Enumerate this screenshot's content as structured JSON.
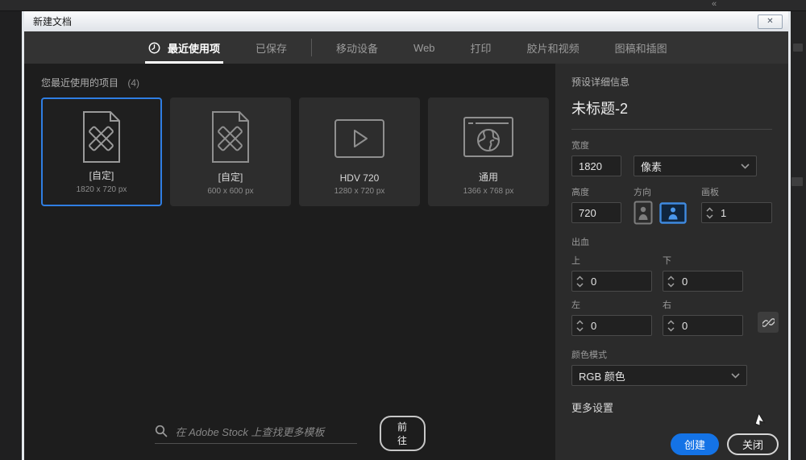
{
  "background": {
    "collapse_glyph": "«"
  },
  "window": {
    "title": "新建文档",
    "close_glyph": "✕"
  },
  "tabs": [
    {
      "label": "最近使用项"
    },
    {
      "label": "已保存"
    },
    {
      "label": "移动设备"
    },
    {
      "label": "Web"
    },
    {
      "label": "打印"
    },
    {
      "label": "胶片和视频"
    },
    {
      "label": "图稿和插图"
    }
  ],
  "recent": {
    "heading": "您最近使用的项目",
    "count": "(4)",
    "cards": [
      {
        "name": "[自定]",
        "dims": "1820 x 720 px",
        "icon": "custom-document-icon",
        "selected": true
      },
      {
        "name": "[自定]",
        "dims": "600 x 600 px",
        "icon": "custom-document-icon",
        "selected": false
      },
      {
        "name": "HDV 720",
        "dims": "1280 x 720 px",
        "icon": "video-icon",
        "selected": false
      },
      {
        "name": "通用",
        "dims": "1366 x 768 px",
        "icon": "web-browser-icon",
        "selected": false
      }
    ]
  },
  "search": {
    "placeholder": "在 Adobe Stock 上查找更多模板",
    "go_label": "前往"
  },
  "panel": {
    "heading": "预设详细信息",
    "doc_title": "未标题-2",
    "width_label": "宽度",
    "width_value": "1820",
    "unit_value": "像素",
    "height_label": "高度",
    "height_value": "720",
    "orientation_label": "方向",
    "artboard_label": "画板",
    "artboard_value": "1",
    "bleed_label": "出血",
    "bleed_top_label": "上",
    "bleed_top_value": "0",
    "bleed_bottom_label": "下",
    "bleed_bottom_value": "0",
    "bleed_left_label": "左",
    "bleed_left_value": "0",
    "bleed_right_label": "右",
    "bleed_right_value": "0",
    "color_mode_label": "颜色模式",
    "color_mode_value": "RGB 颜色",
    "more_settings_label": "更多设置",
    "create_label": "创建",
    "close_label": "关闭"
  },
  "colors": {
    "accent": "#1473e6",
    "selection_border": "#2f7ee3",
    "orientation_active": "#3f8ae0"
  }
}
